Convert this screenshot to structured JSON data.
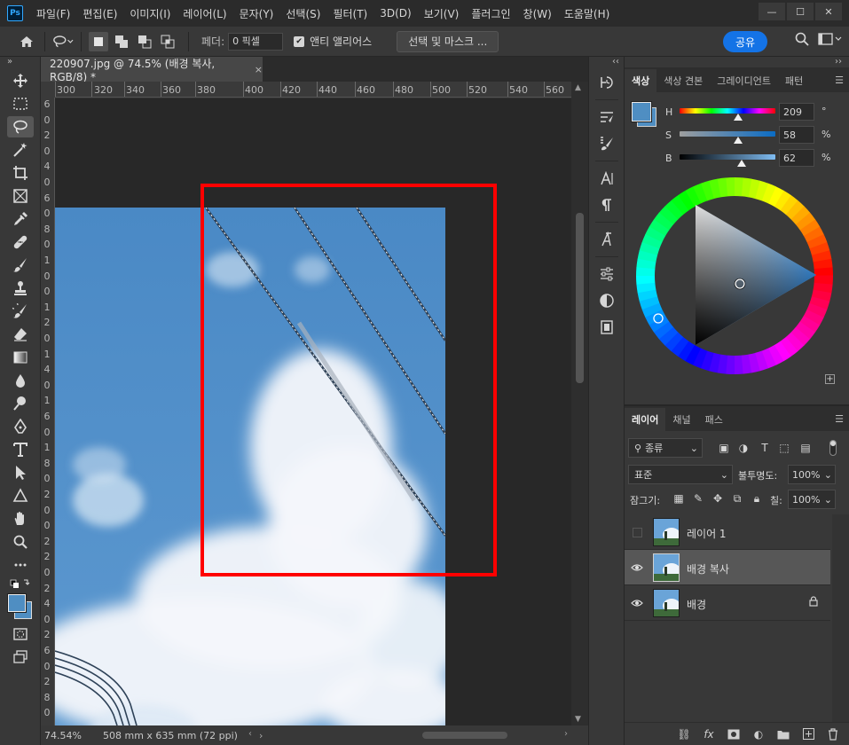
{
  "app": {
    "logo": "Ps"
  },
  "menu": [
    "파일(F)",
    "편집(E)",
    "이미지(I)",
    "레이어(L)",
    "문자(Y)",
    "선택(S)",
    "필터(T)",
    "3D(D)",
    "보기(V)",
    "플러그인",
    "창(W)",
    "도움말(H)"
  ],
  "window_controls": {
    "minimize": "—",
    "maximize": "☐",
    "close": "✕"
  },
  "options": {
    "feather_label": "페더:",
    "feather_value": "0 픽셀",
    "antialias_label": "앤티 앨리어스",
    "select_mask_label": "선택 및 마스크 ...",
    "share_label": "공유"
  },
  "document": {
    "tab_title": "220907.jpg @ 74.5% (배경 복사, RGB/8) *",
    "tab_close": "×",
    "ruler_top": [
      "300",
      "320",
      "340",
      "360",
      "380",
      "400",
      "420",
      "440",
      "460",
      "480",
      "500",
      "520",
      "540",
      "560"
    ],
    "ruler_left": [
      "6",
      "0",
      "2",
      "0",
      "4",
      "0",
      "6",
      "0",
      "8",
      "0",
      "1",
      "0",
      "0",
      "1",
      "2",
      "0",
      "1",
      "4",
      "0",
      "1",
      "6",
      "0",
      "1",
      "8",
      "0",
      "2",
      "0",
      "0",
      "2",
      "2",
      "0",
      "2",
      "4",
      "0",
      "2",
      "6",
      "0",
      "2",
      "8",
      "0"
    ]
  },
  "status": {
    "zoom": "74.54%",
    "doc_size": "508 mm x 635 mm (72 ppi)",
    "arrow": "›"
  },
  "color_panel": {
    "tabs": [
      "색상",
      "색상 견본",
      "그레이디언트",
      "패턴"
    ],
    "active_tab": "색상",
    "fg_color": "#4f8ec2",
    "h_label": "H",
    "h_value": "209",
    "h_unit": "°",
    "s_label": "S",
    "s_value": "58",
    "s_unit": "%",
    "b_label": "B",
    "b_value": "62",
    "b_unit": "%"
  },
  "layers_panel": {
    "tabs": [
      "레이어",
      "채널",
      "패스"
    ],
    "active_tab": "레이어",
    "filter_label": "종류",
    "blend_mode": "표준",
    "opacity_label": "불투명도:",
    "opacity_value": "100%",
    "lock_label": "잠그기:",
    "fill_label": "칠:",
    "fill_value": "100%",
    "layers": [
      {
        "name": "레이어 1",
        "visible": false,
        "selected": false,
        "locked": false
      },
      {
        "name": "배경 복사",
        "visible": true,
        "selected": true,
        "locked": false
      },
      {
        "name": "배경",
        "visible": true,
        "selected": false,
        "locked": true
      }
    ],
    "bottom_fx": "fx"
  },
  "selection_highlight_color": "#ff0000"
}
